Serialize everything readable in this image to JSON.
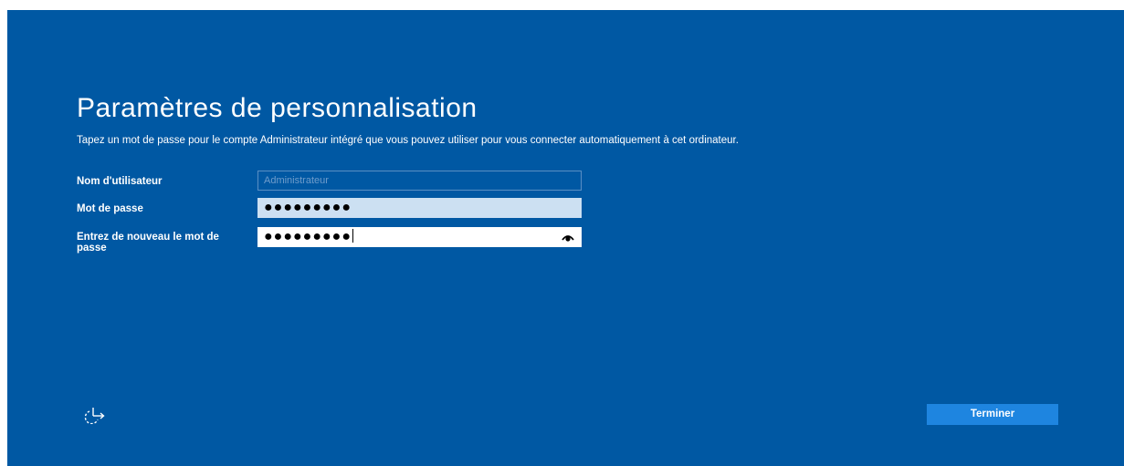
{
  "page": {
    "title": "Paramètres de personnalisation",
    "description": "Tapez un mot de passe pour le compte Administrateur intégré que vous pouvez utiliser pour vous connecter automatiquement à cet ordinateur."
  },
  "form": {
    "username": {
      "label": "Nom d'utilisateur",
      "placeholder": "Administrateur"
    },
    "password": {
      "label": "Mot de passe",
      "value": "●●●●●●●●●"
    },
    "confirm_password": {
      "label": "Entrez de nouveau le mot de passe",
      "value": "●●●●●●●●●"
    }
  },
  "footer": {
    "accessibility_icon": "ease-of-access-icon",
    "finish_label": "Terminer"
  },
  "colors": {
    "background": "#0058a3",
    "password_field": "#cce0f2",
    "finish_button": "#1e85e0"
  },
  "icons": {
    "reveal": "eye-reveal-icon"
  }
}
